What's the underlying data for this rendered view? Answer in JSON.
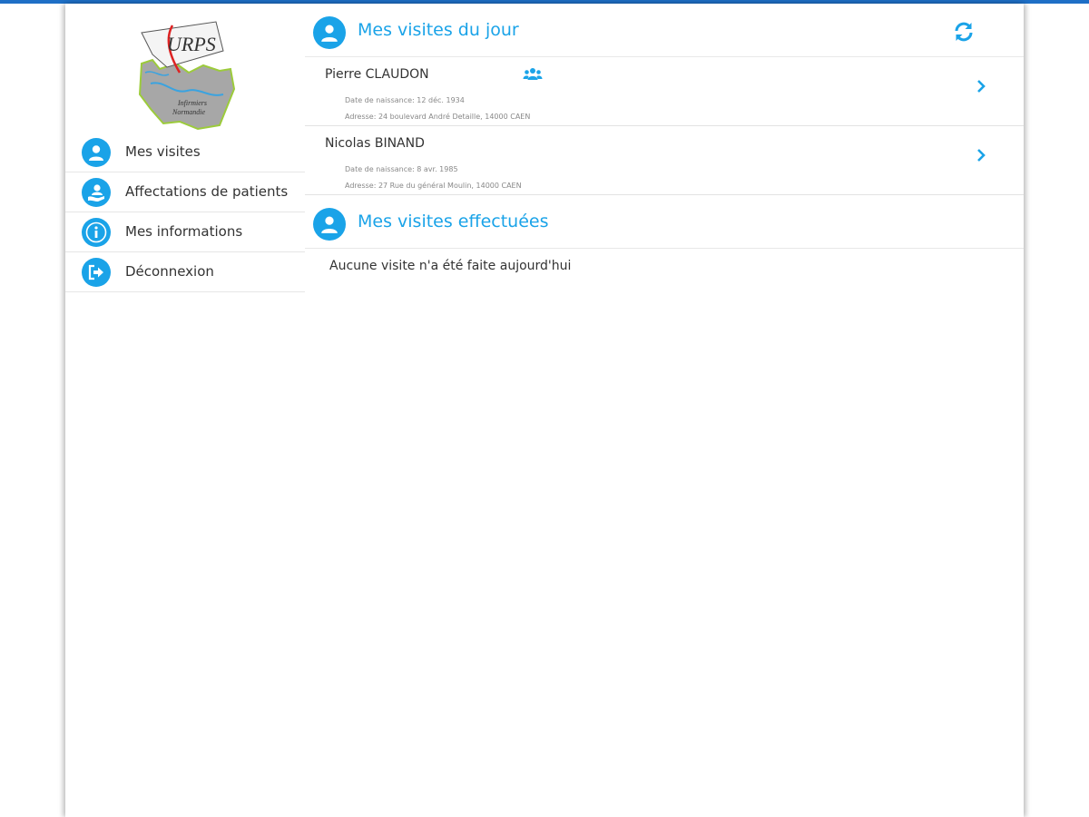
{
  "logo": {
    "brand": "URPS",
    "line1": "Infirmiers",
    "line2": "Normandie"
  },
  "colors": {
    "accent": "#1aa3e8",
    "top_bar": "#1e6fc6"
  },
  "sidebar": {
    "items": [
      {
        "label": "Mes visites",
        "icon": "user-circle-icon"
      },
      {
        "label": "Affectations de patients",
        "icon": "user-assign-icon"
      },
      {
        "label": "Mes informations",
        "icon": "info-icon"
      },
      {
        "label": "Déconnexion",
        "icon": "logout-icon"
      }
    ]
  },
  "today": {
    "title": "Mes visites du jour",
    "refresh_icon": "refresh-icon",
    "visits": [
      {
        "name": "Pierre CLAUDON",
        "birth": "Date de naissance: 12 déc. 1934",
        "address": "Adresse: 24 boulevard André Detaille, 14000 CAEN",
        "group_icon": "users-icon"
      },
      {
        "name": "Nicolas BINAND",
        "birth": "Date de naissance: 8 avr. 1985",
        "address": "Adresse: 27 Rue du général Moulin, 14000 CAEN"
      }
    ]
  },
  "done": {
    "title": "Mes visites effectuées",
    "empty": "Aucune visite n'a été faite aujourd'hui"
  }
}
